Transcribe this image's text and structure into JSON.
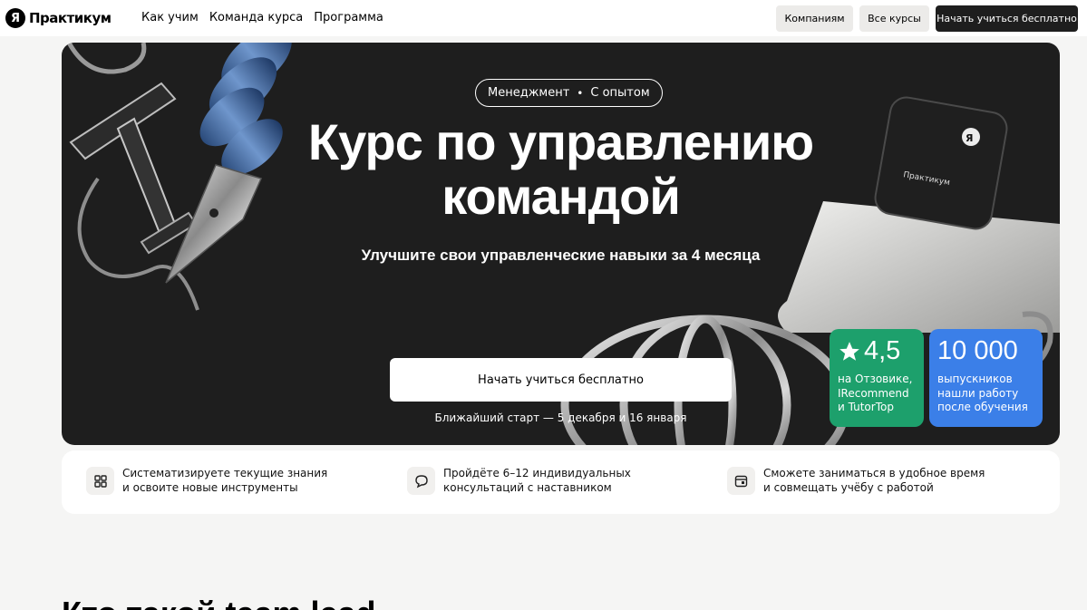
{
  "header": {
    "logo_mark": "Я",
    "logo_text": "Практикум",
    "nav": [
      "Как учим",
      "Команда курса",
      "Программа"
    ],
    "companies_label": "Компаниям",
    "all_courses_label": "Все курсы",
    "start_label": "Начать учиться бесплатно"
  },
  "hero": {
    "tag_1": "Менеджмент",
    "tag_separator": "•",
    "tag_2": "С опытом",
    "title_line1": "Курс по управлению",
    "title_line2": "командой",
    "subtitle": "Улучшите свои управленческие навыки за 4 месяца",
    "cta_label": "Начать учиться бесплатно",
    "start_info": "Ближайший старт — 5 декабря и 16 января",
    "keycap_logo": "Я",
    "keycap_text": "Практикум"
  },
  "badges": {
    "rating_value": "4,5",
    "rating_text": "на Отзовике,\nIRecommend\nи TutorTop",
    "grads_value": "10 000",
    "grads_text": "выпускников\nнашли работу\nпосле обучения"
  },
  "features": [
    {
      "icon": "grid-icon",
      "text": "Систематизируете текущие знания\nи освоите новые инструменты"
    },
    {
      "icon": "chat-icon",
      "text": "Пройдёте 6–12 индивидуальных\nконсультаций с наставником"
    },
    {
      "icon": "calendar-icon",
      "text": "Сможете заниматься в удобное время\nи совмещать учёбу с работой"
    }
  ],
  "section": {
    "heading_partial": "Кто такой team lead"
  },
  "colors": {
    "hero_bg": "#1e1e1e",
    "rating_badge": "#1da06c",
    "grads_badge": "#3b7fe8",
    "page_bg": "#f5f5f4"
  }
}
